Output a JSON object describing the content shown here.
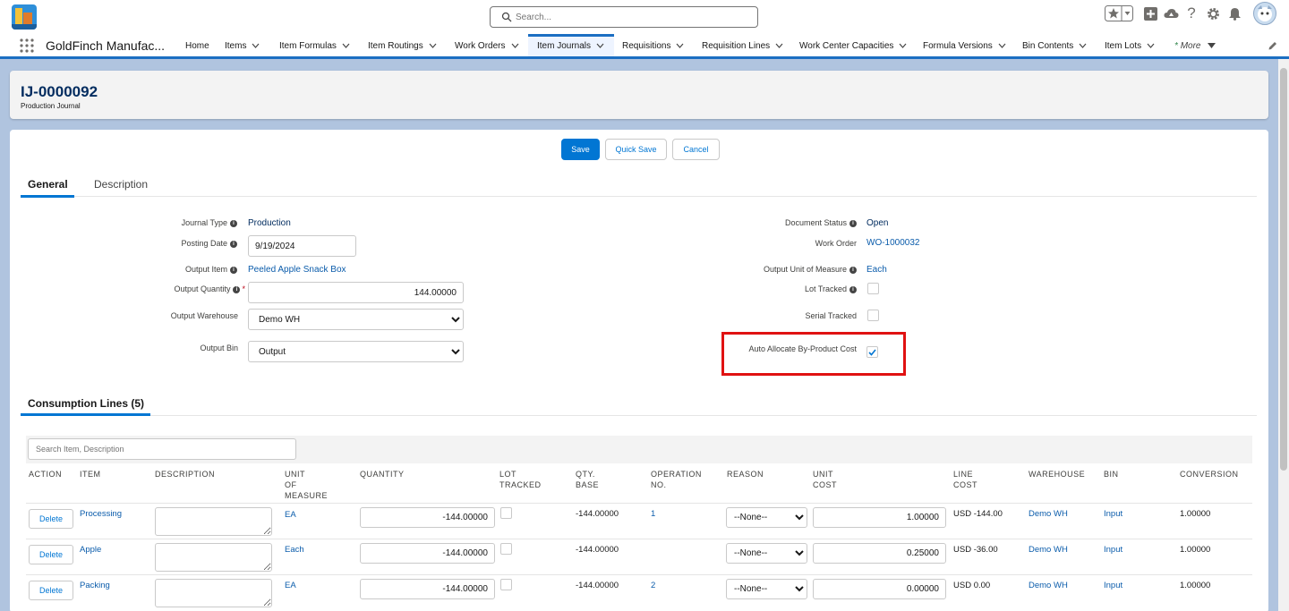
{
  "topbar": {
    "search_placeholder": "Search..."
  },
  "nav": {
    "app_name": "GoldFinch Manufac...",
    "items": [
      {
        "label": "Home",
        "chevron": false
      },
      {
        "label": "Items",
        "chevron": true
      },
      {
        "label": "Item Formulas",
        "chevron": true
      },
      {
        "label": "Item Routings",
        "chevron": true
      },
      {
        "label": "Work Orders",
        "chevron": true
      },
      {
        "label": "Item Journals",
        "chevron": true,
        "active": true
      },
      {
        "label": "Requisitions",
        "chevron": true
      },
      {
        "label": "Requisition Lines",
        "chevron": true
      },
      {
        "label": "Work Center Capacities",
        "chevron": true
      },
      {
        "label": "Formula Versions",
        "chevron": true
      },
      {
        "label": "Bin Contents",
        "chevron": true
      },
      {
        "label": "Item Lots",
        "chevron": true
      }
    ],
    "more_label": "More"
  },
  "record": {
    "title": "IJ-0000092",
    "subtitle": "Production Journal"
  },
  "actions": {
    "save": "Save",
    "quick_save": "Quick Save",
    "cancel": "Cancel"
  },
  "tabs": {
    "general": "General",
    "description": "Description"
  },
  "form": {
    "journal_type_label": "Journal Type",
    "journal_type_value": "Production",
    "posting_date_label": "Posting Date",
    "posting_date_value": "9/19/2024",
    "output_item_label": "Output Item",
    "output_item_value": "Peeled Apple Snack Box",
    "output_quantity_label": "Output Quantity",
    "output_quantity_value": "144.00000",
    "output_warehouse_label": "Output Warehouse",
    "output_warehouse_value": "Demo WH",
    "output_bin_label": "Output Bin",
    "output_bin_value": "Output",
    "document_status_label": "Document Status",
    "document_status_value": "Open",
    "work_order_label": "Work Order",
    "work_order_value": "WO-1000032",
    "output_uom_label": "Output Unit of Measure",
    "output_uom_value": "Each",
    "lot_tracked_label": "Lot Tracked",
    "lot_tracked_checked": false,
    "serial_tracked_label": "Serial Tracked",
    "serial_tracked_checked": false,
    "auto_allocate_label": "Auto Allocate By-Product Cost",
    "auto_allocate_checked": true,
    "required_marker": "*",
    "info_glyph": "i"
  },
  "consumption": {
    "title": "Consumption Lines (5)",
    "search_placeholder": "Search Item, Description",
    "headers": {
      "action": "ACTION",
      "item": "ITEM",
      "description": "DESCRIPTION",
      "uom_1": "UNIT",
      "uom_2": "OF",
      "uom_3": "MEASURE",
      "quantity": "QUANTITY",
      "lot_1": "LOT",
      "lot_2": "TRACKED",
      "qty_base_1": "QTY.",
      "qty_base_2": "BASE",
      "op_1": "OPERATION",
      "op_2": "NO.",
      "reason": "REASON",
      "unit_cost_1": "UNIT",
      "unit_cost_2": "COST",
      "line_cost_1": "LINE",
      "line_cost_2": "COST",
      "warehouse": "WAREHOUSE",
      "bin": "BIN",
      "conversion": "CONVERSION"
    },
    "rows": [
      {
        "action": "Delete",
        "item": "Processing",
        "uom": "EA",
        "quantity": "-144.00000",
        "qty_base": "-144.00000",
        "operation": "1",
        "reason": "--None--",
        "unit_cost": "1.00000",
        "line_cost": "USD -144.00",
        "warehouse": "Demo WH",
        "bin": "Input",
        "conversion": "1.00000"
      },
      {
        "action": "Delete",
        "item": "Apple",
        "uom": "Each",
        "quantity": "-144.00000",
        "qty_base": "-144.00000",
        "operation": "",
        "reason": "--None--",
        "unit_cost": "0.25000",
        "line_cost": "USD -36.00",
        "warehouse": "Demo WH",
        "bin": "Input",
        "conversion": "1.00000"
      },
      {
        "action": "Delete",
        "item": "Packing",
        "uom": "EA",
        "quantity": "-144.00000",
        "qty_base": "-144.00000",
        "operation": "2",
        "reason": "--None--",
        "unit_cost": "0.00000",
        "line_cost": "USD 0.00",
        "warehouse": "Demo WH",
        "bin": "Input",
        "conversion": "1.00000"
      }
    ]
  },
  "colors": {
    "brand": "#0176d3",
    "link": "#0b5cab",
    "highlight": "#e01212"
  }
}
